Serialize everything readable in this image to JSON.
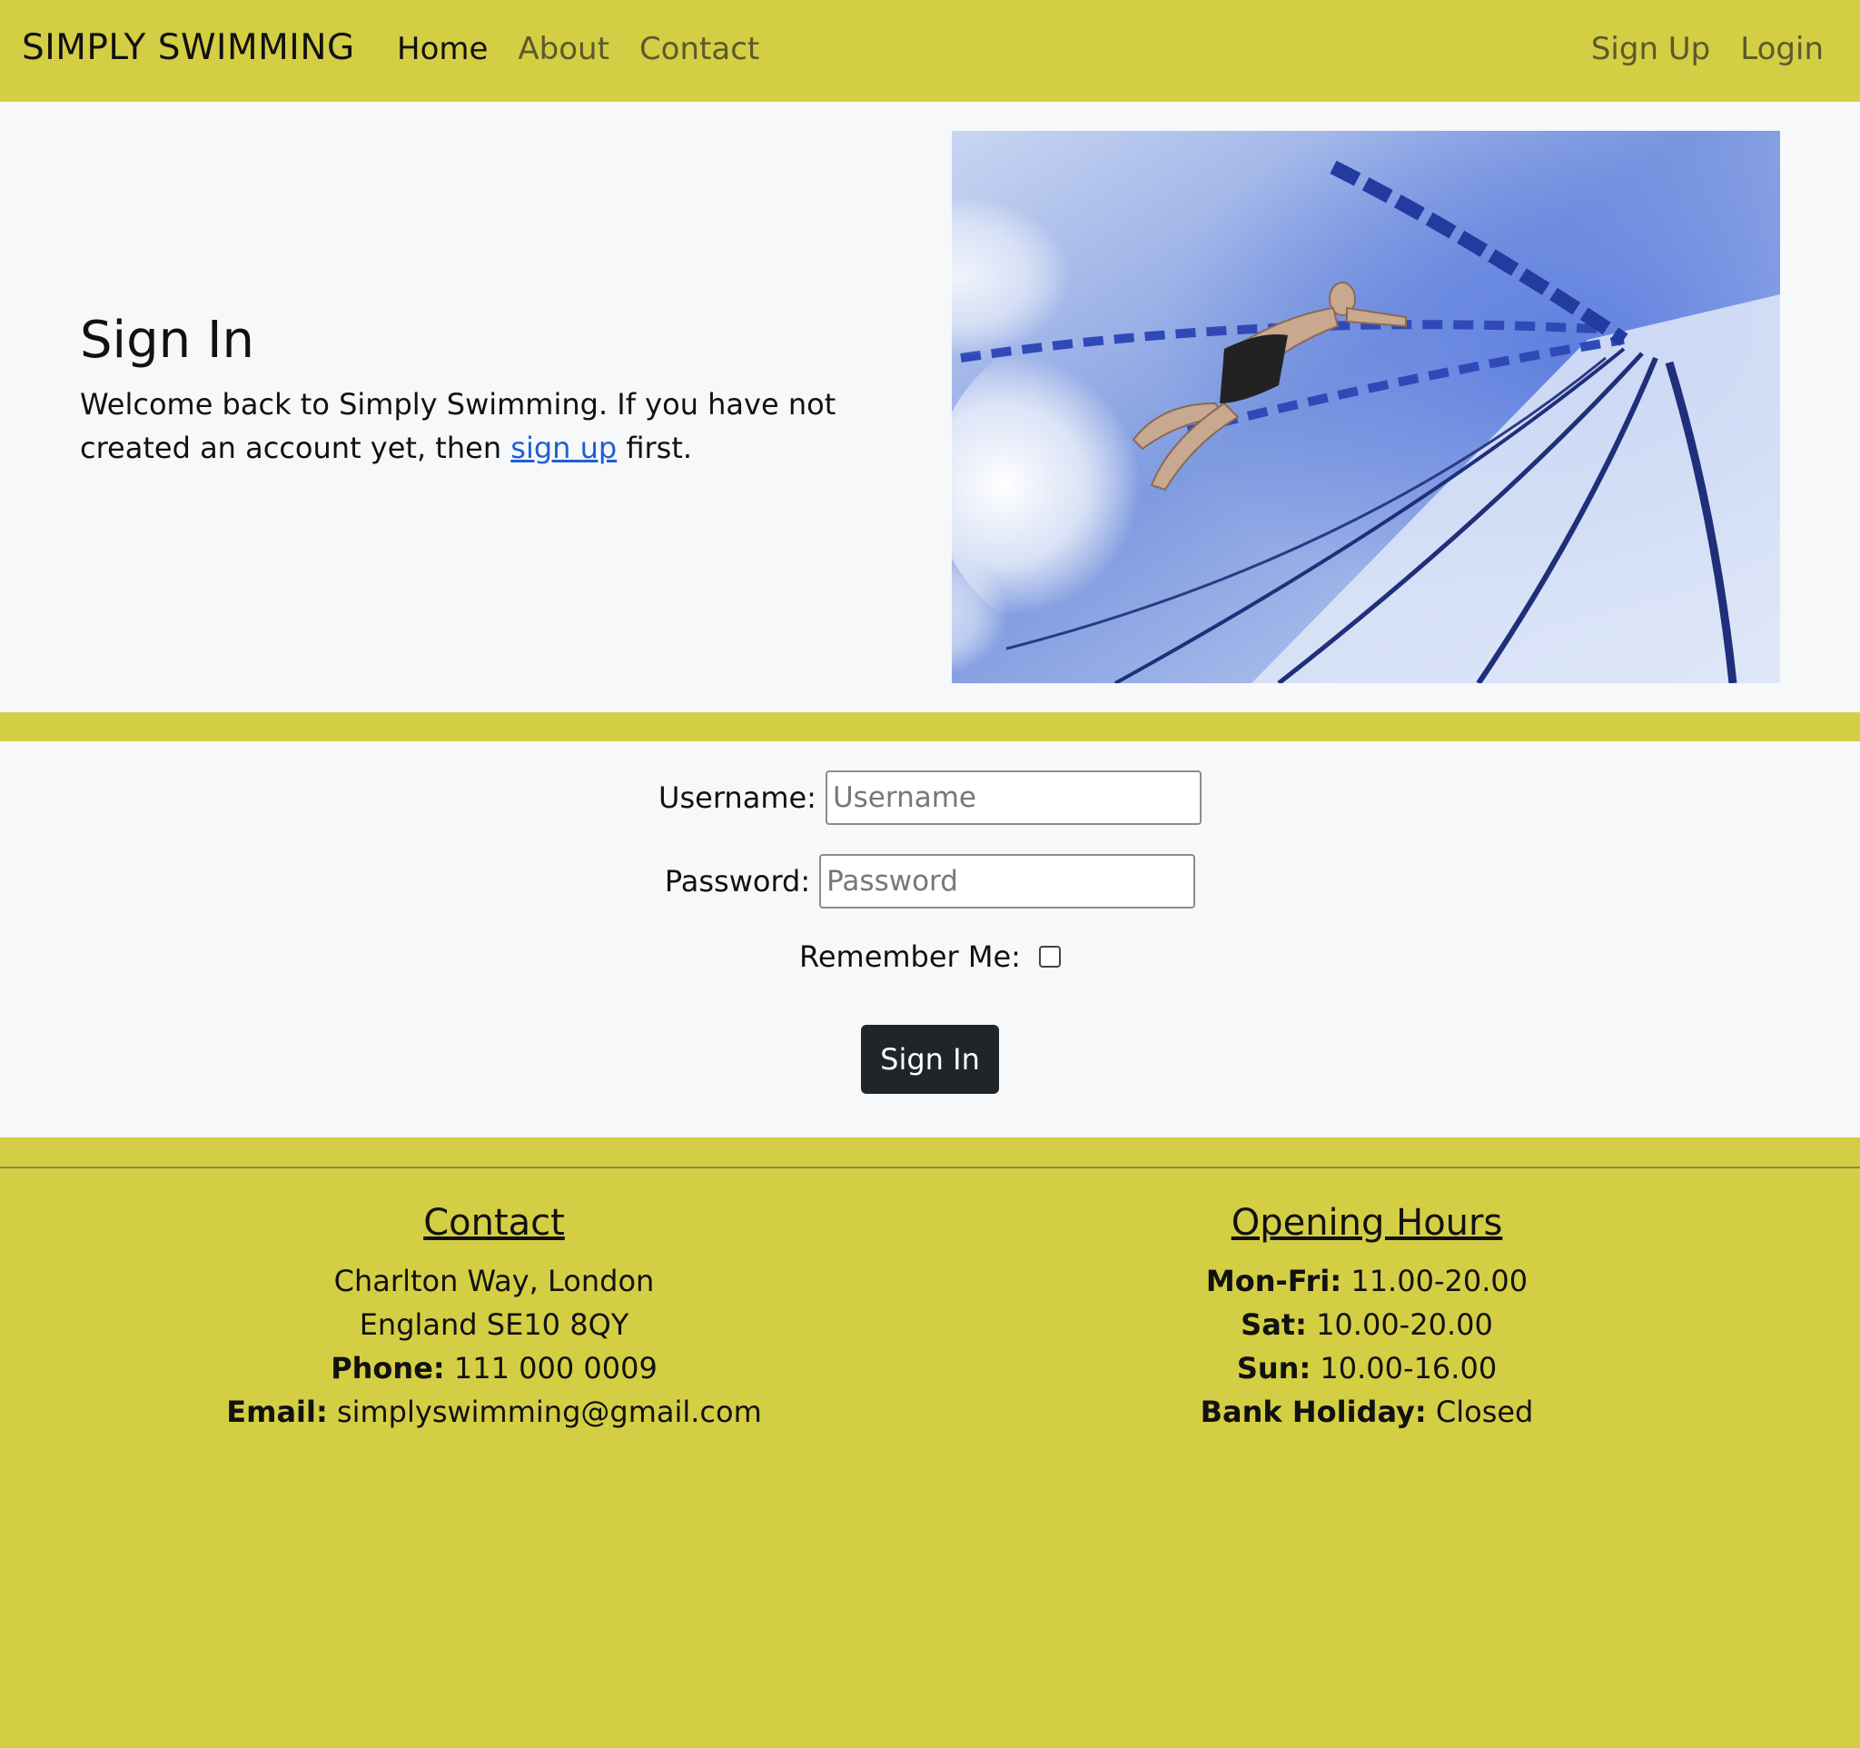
{
  "navbar": {
    "brand": "SIMPLY SWIMMING",
    "left_links": [
      "Home",
      "About",
      "Contact"
    ],
    "right_links": [
      "Sign Up",
      "Login"
    ],
    "active": "Home"
  },
  "hero": {
    "title": "Sign In",
    "body_before": "Welcome back to Simply Swimming. If you have not created an account yet, then ",
    "body_link": "sign up",
    "body_after": " first.",
    "image_alt": "swimmer-underwater-image"
  },
  "form": {
    "username_label": "Username:",
    "username_placeholder": "Username",
    "password_label": "Password:",
    "password_placeholder": "Password",
    "remember_label": "Remember Me:",
    "submit_label": "Sign In"
  },
  "footer": {
    "contact": {
      "heading": "Contact",
      "address_line1": "Charlton Way, London",
      "address_line2": "England SE10 8QY",
      "phone_label": "Phone:",
      "phone_value": " 111 000 0009",
      "email_label": "Email:",
      "email_value": " simplyswimming@gmail.com"
    },
    "hours": {
      "heading": "Opening Hours",
      "rows": [
        {
          "label": "Mon-Fri:",
          "value": " 11.00-20.00"
        },
        {
          "label": "Sat:",
          "value": " 10.00-20.00"
        },
        {
          "label": "Sun:",
          "value": " 10.00-16.00"
        },
        {
          "label": "Bank Holiday:",
          "value": " Closed"
        }
      ]
    }
  },
  "colors": {
    "accent": "#d4ce44",
    "page_bg": "#f7f8fa",
    "link": "#1f5fd6",
    "button": "#212429"
  }
}
